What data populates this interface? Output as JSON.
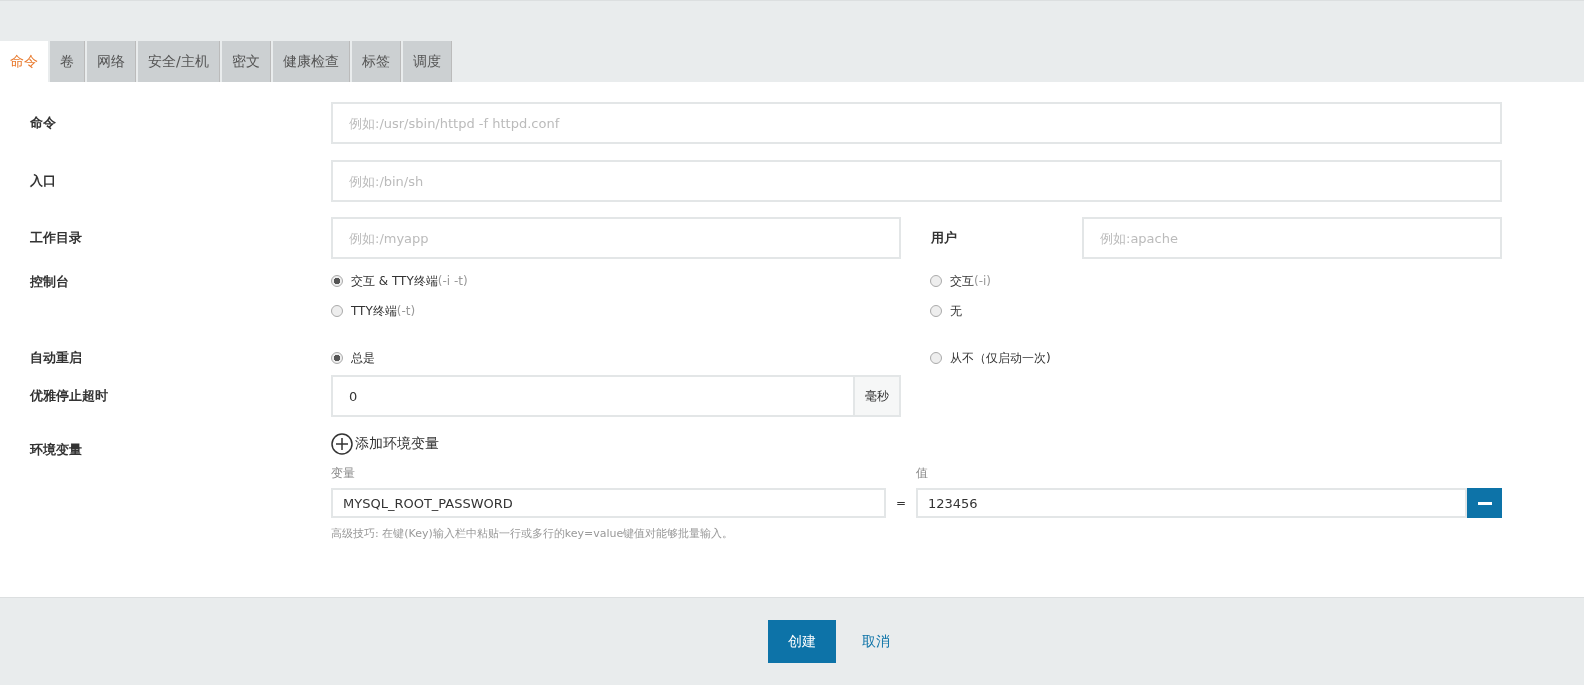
{
  "tabs": [
    {
      "label": "命令",
      "selected": true
    },
    {
      "label": "卷",
      "selected": false
    },
    {
      "label": "网络",
      "selected": false
    },
    {
      "label": "安全/主机",
      "selected": false
    },
    {
      "label": "密文",
      "selected": false
    },
    {
      "label": "健康检查",
      "selected": false
    },
    {
      "label": "标签",
      "selected": false
    },
    {
      "label": "调度",
      "selected": false
    }
  ],
  "command": {
    "label": "命令",
    "placeholder": "例如:/usr/sbin/httpd -f httpd.conf"
  },
  "entrypoint": {
    "label": "入口",
    "placeholder": "例如:/bin/sh"
  },
  "workdir": {
    "label": "工作目录",
    "placeholder": "例如:/myapp"
  },
  "user": {
    "label": "用户",
    "placeholder": "例如:apache"
  },
  "console": {
    "label": "控制台",
    "options": [
      {
        "label": "交互 & TTY终端",
        "hint": "(-i -t)",
        "selected": true
      },
      {
        "label": "交互",
        "hint": "(-i)",
        "selected": false
      },
      {
        "label": "TTY终端",
        "hint": "(-t)",
        "selected": false
      },
      {
        "label": "无",
        "selected": false
      }
    ]
  },
  "restart": {
    "label": "自动重启",
    "options": [
      {
        "label": "总是",
        "selected": true
      },
      {
        "label": "从不（仅启动一次)",
        "selected": false
      }
    ]
  },
  "stop_timeout": {
    "label": "优雅停止超时",
    "value": "0",
    "unit": "毫秒"
  },
  "env": {
    "label": "环境变量",
    "add_label": "添加环境变量",
    "key_header": "变量",
    "value_header": "值",
    "rows": [
      {
        "key": "MYSQL_ROOT_PASSWORD",
        "separator": "=",
        "value": "123456"
      }
    ],
    "tip": "高级技巧: 在键(Key)输入栏中粘贴一行或多行的key=value键值对能够批量输入。"
  },
  "buttons": {
    "create": "创建",
    "cancel": "取消"
  }
}
